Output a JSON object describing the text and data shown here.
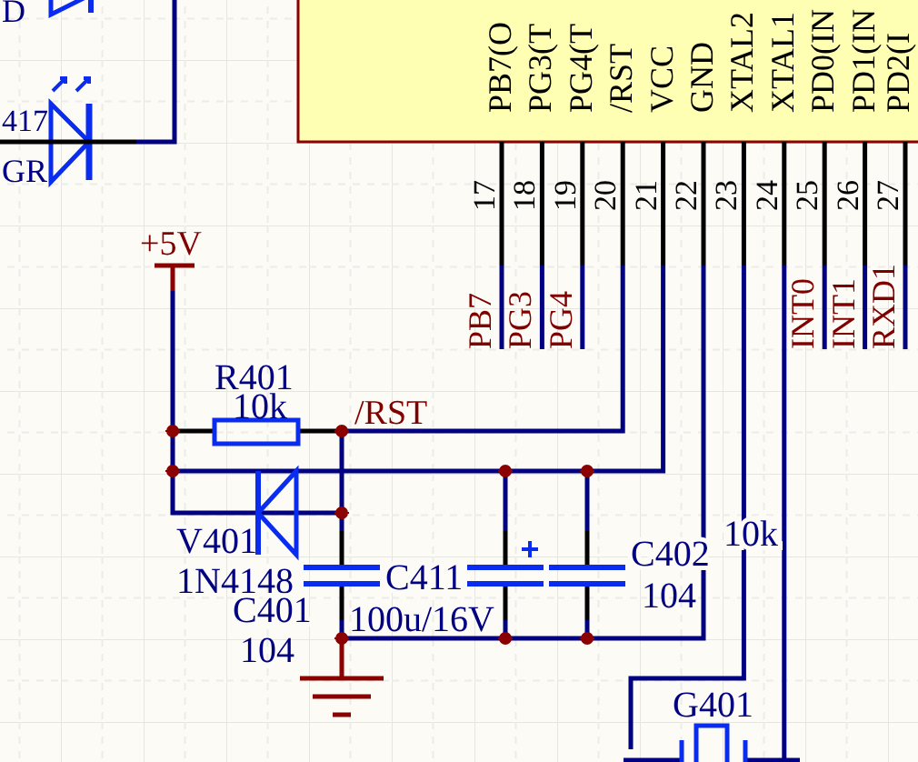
{
  "partial_parts": [
    {
      "text": "D"
    },
    {
      "text": "417"
    },
    {
      "text": "GR"
    }
  ],
  "chip": {
    "pins": [
      {
        "number": "17",
        "name": "PB7(O",
        "net": "PB7"
      },
      {
        "number": "18",
        "name": "PG3(T",
        "net": "PG3"
      },
      {
        "number": "19",
        "name": "PG4(T",
        "net": "PG4"
      },
      {
        "number": "20",
        "name": "/RST"
      },
      {
        "number": "21",
        "name": "VCC"
      },
      {
        "number": "22",
        "name": "GND"
      },
      {
        "number": "23",
        "name": "XTAL2"
      },
      {
        "number": "24",
        "name": "XTAL1"
      },
      {
        "number": "25",
        "name": "PD0(IN",
        "net": "INT0"
      },
      {
        "number": "26",
        "name": "PD1(IN",
        "net": "INT1"
      },
      {
        "number": "27",
        "name": "PD2(I",
        "net": "RXD1"
      }
    ]
  },
  "power_port": {
    "label": "+5V"
  },
  "net_label": {
    "text": "/RST"
  },
  "components": [
    {
      "kind": "resistor",
      "designator": "R401",
      "value": "10k"
    },
    {
      "kind": "diode",
      "designator": "V401",
      "value": "1N4148"
    },
    {
      "kind": "capacitor",
      "designator": "C401",
      "value": "104"
    },
    {
      "kind": "electrolytic",
      "designator": "C411",
      "value": "100u/16V"
    },
    {
      "kind": "capacitor",
      "designator": "C402",
      "value": "104"
    },
    {
      "kind": "crystal",
      "designator": "G401"
    }
  ],
  "free_label": {
    "text": "10k"
  }
}
